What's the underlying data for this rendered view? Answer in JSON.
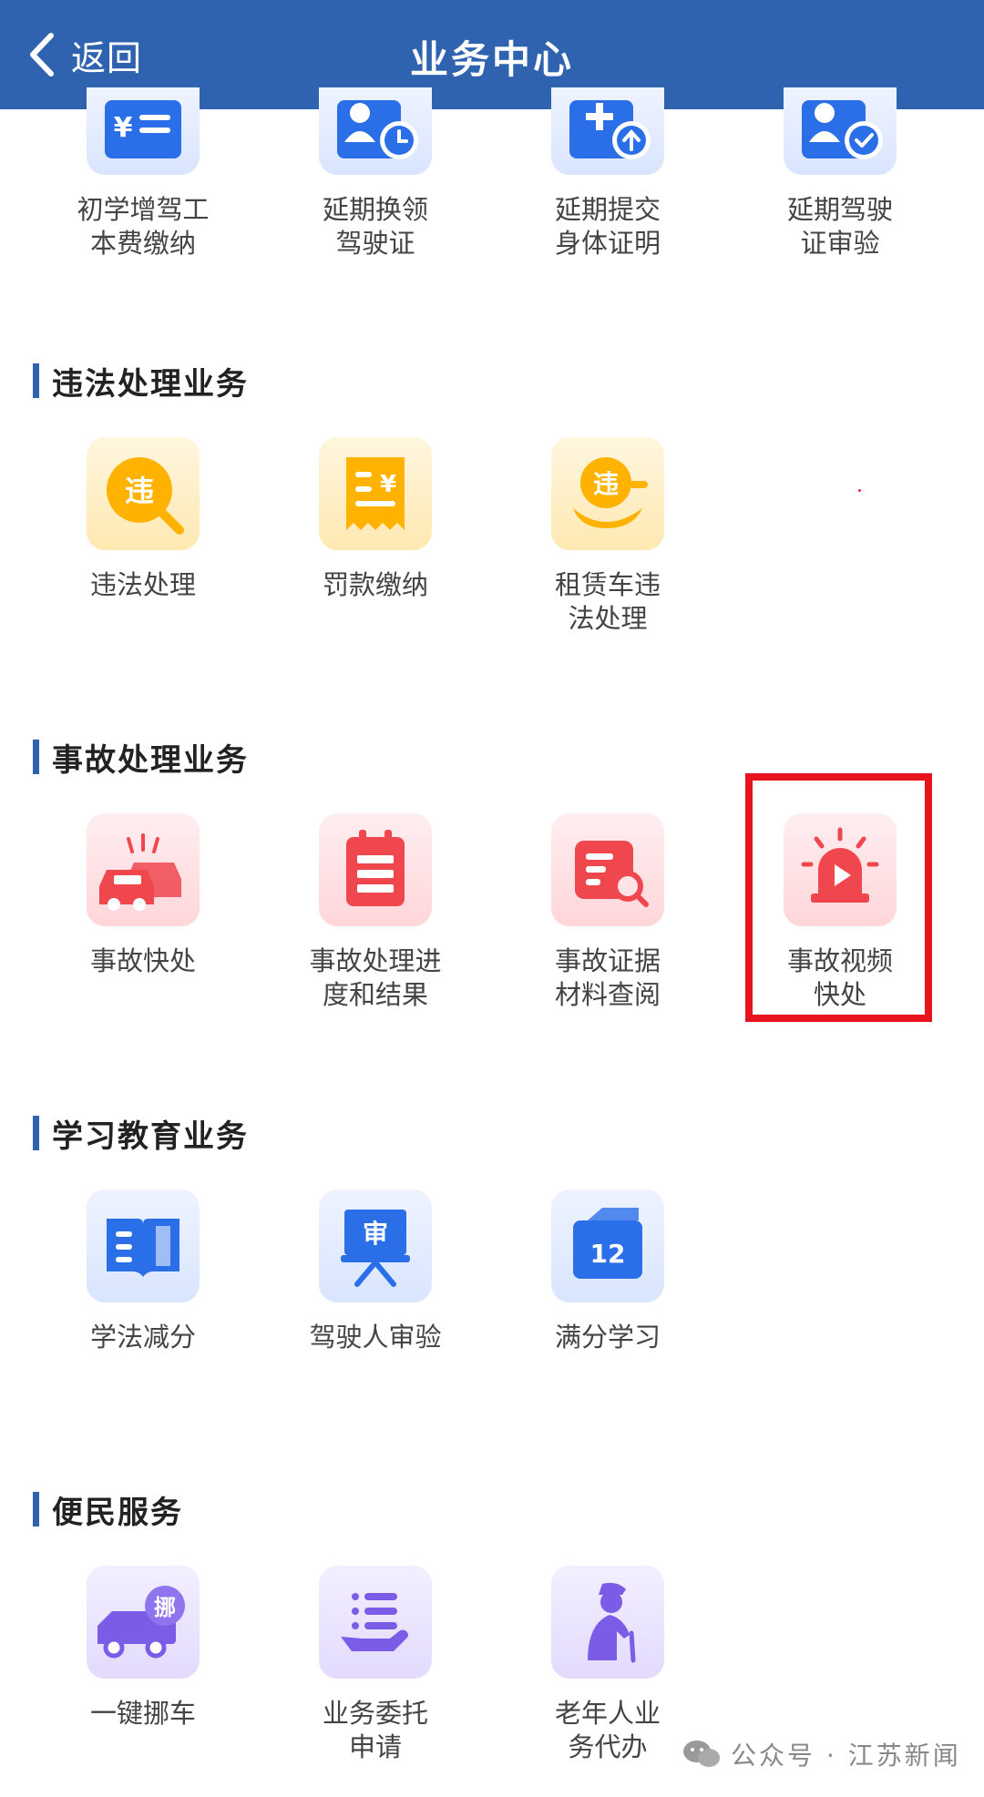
{
  "header": {
    "back_label": "返回",
    "title": "业务中心"
  },
  "rows": [
    {
      "items": [
        {
          "label": "初学增驾工\n本费缴纳",
          "icon": "fee-payment-icon",
          "color": "blue"
        },
        {
          "label": "延期换领\n驾驶证",
          "icon": "license-renew-icon",
          "color": "blue"
        },
        {
          "label": "延期提交\n身体证明",
          "icon": "health-cert-upload-icon",
          "color": "blue"
        },
        {
          "label": "延期驾驶\n证审验",
          "icon": "license-verify-icon",
          "color": "blue"
        }
      ]
    }
  ],
  "sections": [
    {
      "title": "违法处理业务",
      "items": [
        {
          "label": "违法处理",
          "icon": "violation-search-icon",
          "color": "yellow"
        },
        {
          "label": "罚款缴纳",
          "icon": "fine-receipt-icon",
          "color": "yellow"
        },
        {
          "label": "租赁车违\n法处理",
          "icon": "rental-violation-icon",
          "color": "yellow"
        }
      ]
    },
    {
      "title": "事故处理业务",
      "items": [
        {
          "label": "事故快处",
          "icon": "car-crash-icon",
          "color": "red"
        },
        {
          "label": "事故处理进\n度和结果",
          "icon": "clipboard-list-icon",
          "color": "red"
        },
        {
          "label": "事故证据\n材料查阅",
          "icon": "document-search-icon",
          "color": "red"
        },
        {
          "label": "事故视频\n快处",
          "icon": "alarm-light-video-icon",
          "color": "red"
        }
      ]
    },
    {
      "title": "学习教育业务",
      "items": [
        {
          "label": "学法减分",
          "icon": "open-book-icon",
          "color": "blue"
        },
        {
          "label": "驾驶人审验",
          "icon": "review-board-icon",
          "color": "blue"
        },
        {
          "label": "满分学习",
          "icon": "calendar-12-icon",
          "color": "blue"
        }
      ]
    },
    {
      "title": "便民服务",
      "items": [
        {
          "label": "一键挪车",
          "icon": "tow-truck-icon",
          "color": "purple"
        },
        {
          "label": "业务委托\n申请",
          "icon": "delegate-hand-icon",
          "color": "purple"
        },
        {
          "label": "老年人业\n务代办",
          "icon": "elderly-person-icon",
          "color": "purple"
        }
      ]
    }
  ],
  "icon_text": {
    "fee_symbol": "¥",
    "violation_char": "违",
    "tow_char": "挪",
    "review_char": "审",
    "calendar_num": "12"
  },
  "watermark": {
    "text": "公众号 · 江苏新闻"
  },
  "colors": {
    "header_bg": "#2f63b0",
    "accent_blue": "#2b6fe8",
    "accent_yellow": "#ffb300",
    "accent_red": "#f0474f",
    "accent_purple": "#7b5ce6",
    "highlight": "#e8141d"
  }
}
